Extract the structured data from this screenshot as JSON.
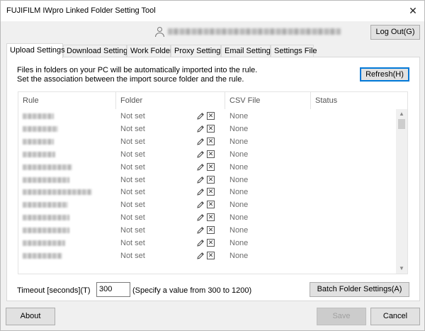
{
  "window": {
    "title": "FUJIFILM IWpro Linked Folder Setting Tool",
    "close_glyph": "✕"
  },
  "header": {
    "logout_label": "Log Out(G)"
  },
  "tabs": [
    {
      "label": "Upload Settings"
    },
    {
      "label": "Download Settings"
    },
    {
      "label": "Work Folder"
    },
    {
      "label": "Proxy Settings"
    },
    {
      "label": "Email Settings"
    },
    {
      "label": "Settings File"
    }
  ],
  "upload": {
    "description_1": "Files in folders on your PC will be automatically imported into the rule.",
    "description_2": "Set the association between the import source folder and the rule.",
    "refresh_label": "Refresh(H)",
    "columns": {
      "rule": "Rule",
      "folder": "Folder",
      "csv": "CSV File",
      "status": "Status"
    },
    "rows": [
      {
        "folder": "Not set",
        "csv": "None",
        "status": ""
      },
      {
        "folder": "Not set",
        "csv": "None",
        "status": ""
      },
      {
        "folder": "Not set",
        "csv": "None",
        "status": ""
      },
      {
        "folder": "Not set",
        "csv": "None",
        "status": ""
      },
      {
        "folder": "Not set",
        "csv": "None",
        "status": ""
      },
      {
        "folder": "Not set",
        "csv": "None",
        "status": ""
      },
      {
        "folder": "Not set",
        "csv": "None",
        "status": ""
      },
      {
        "folder": "Not set",
        "csv": "None",
        "status": ""
      },
      {
        "folder": "Not set",
        "csv": "None",
        "status": ""
      },
      {
        "folder": "Not set",
        "csv": "None",
        "status": ""
      },
      {
        "folder": "Not set",
        "csv": "None",
        "status": ""
      },
      {
        "folder": "Not set",
        "csv": "None",
        "status": ""
      }
    ],
    "timeout_label": "Timeout [seconds](T)",
    "timeout_value": "300",
    "timeout_hint": "(Specify a value from 300 to 1200)",
    "batch_label": "Batch Folder Settings(A)"
  },
  "footer": {
    "about_label": "About",
    "save_label": "Save",
    "cancel_label": "Cancel"
  },
  "icons": {
    "user": "user-icon",
    "edit": "pencil-icon",
    "clear": "x-box-icon"
  },
  "colors": {
    "focus": "#0078d7"
  }
}
